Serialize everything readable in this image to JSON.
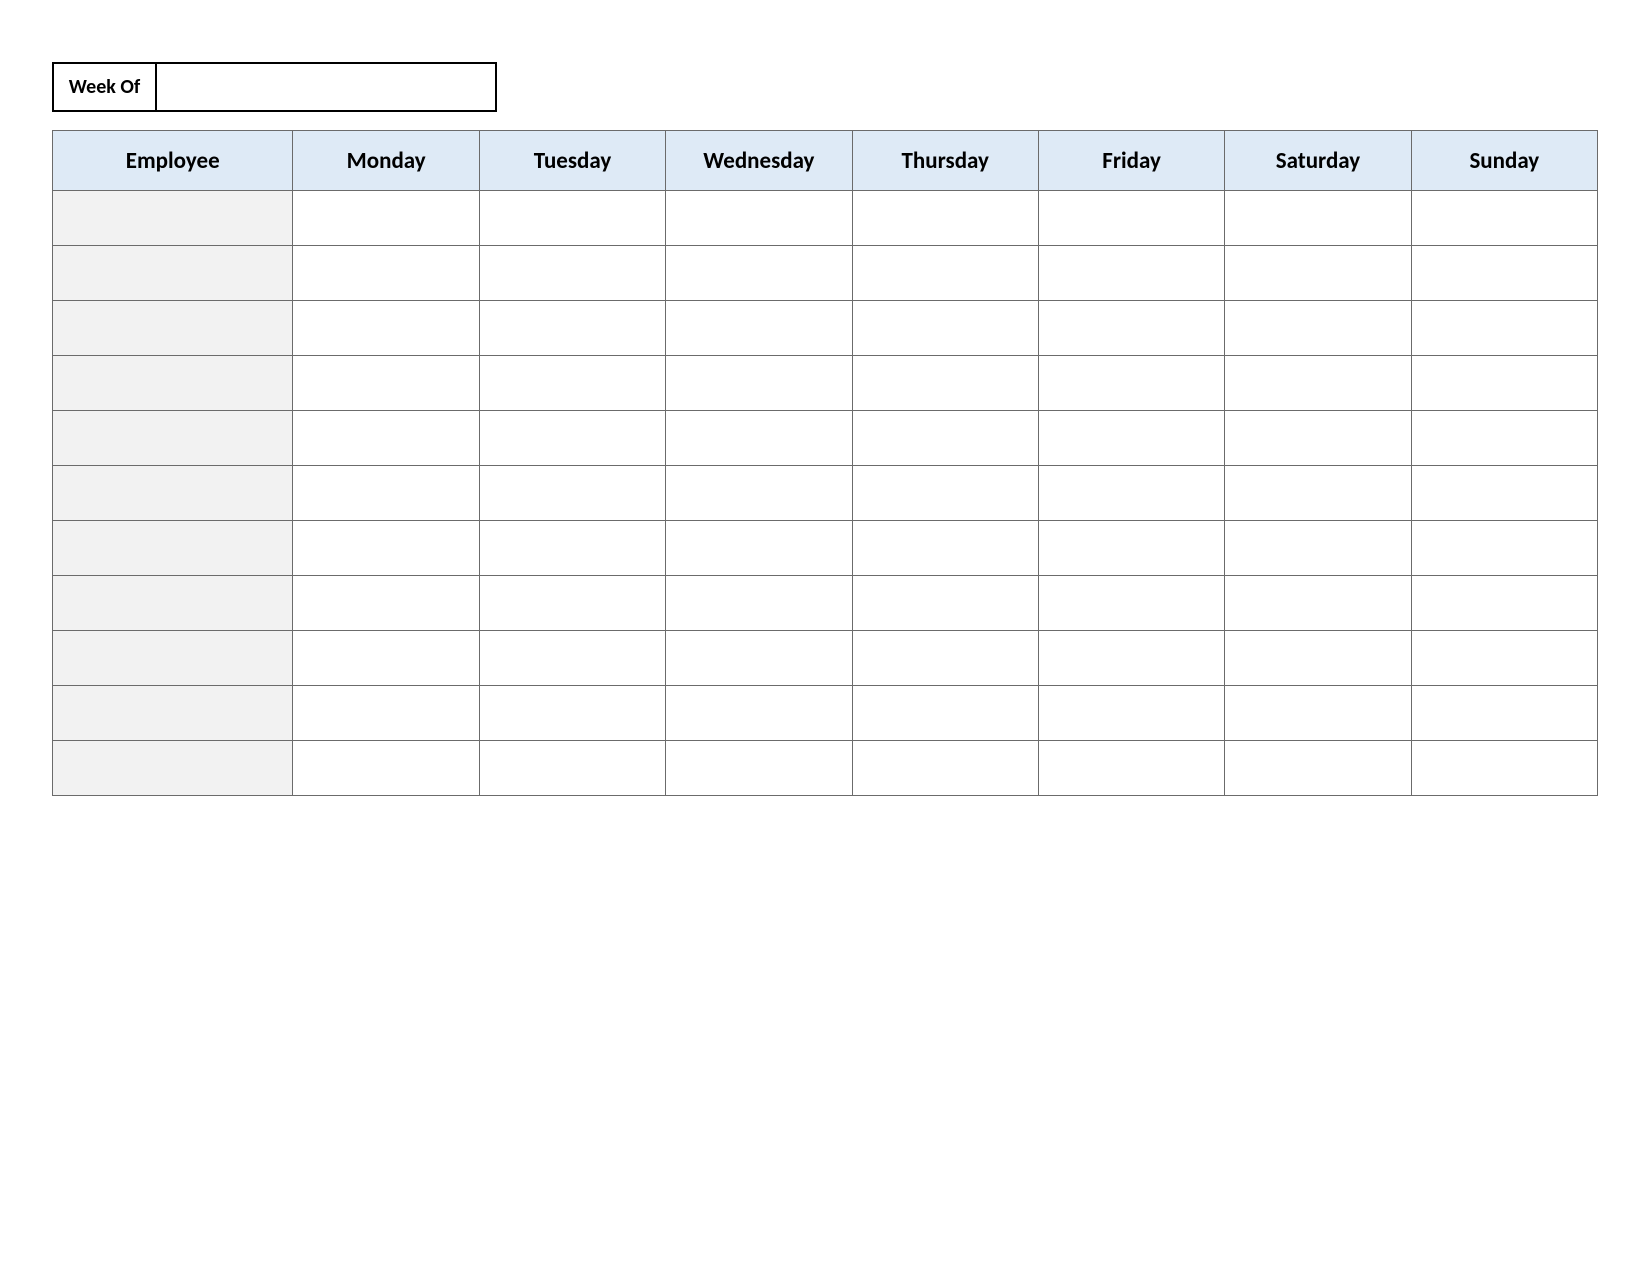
{
  "weekOf": {
    "label": "Week Of",
    "value": ""
  },
  "headers": {
    "employee": "Employee",
    "days": [
      "Monday",
      "Tuesday",
      "Wednesday",
      "Thursday",
      "Friday",
      "Saturday",
      "Sunday"
    ]
  },
  "rows": [
    {
      "employee": "",
      "cells": [
        "",
        "",
        "",
        "",
        "",
        "",
        ""
      ]
    },
    {
      "employee": "",
      "cells": [
        "",
        "",
        "",
        "",
        "",
        "",
        ""
      ]
    },
    {
      "employee": "",
      "cells": [
        "",
        "",
        "",
        "",
        "",
        "",
        ""
      ]
    },
    {
      "employee": "",
      "cells": [
        "",
        "",
        "",
        "",
        "",
        "",
        ""
      ]
    },
    {
      "employee": "",
      "cells": [
        "",
        "",
        "",
        "",
        "",
        "",
        ""
      ]
    },
    {
      "employee": "",
      "cells": [
        "",
        "",
        "",
        "",
        "",
        "",
        ""
      ]
    },
    {
      "employee": "",
      "cells": [
        "",
        "",
        "",
        "",
        "",
        "",
        ""
      ]
    },
    {
      "employee": "",
      "cells": [
        "",
        "",
        "",
        "",
        "",
        "",
        ""
      ]
    },
    {
      "employee": "",
      "cells": [
        "",
        "",
        "",
        "",
        "",
        "",
        ""
      ]
    },
    {
      "employee": "",
      "cells": [
        "",
        "",
        "",
        "",
        "",
        "",
        ""
      ]
    },
    {
      "employee": "",
      "cells": [
        "",
        "",
        "",
        "",
        "",
        "",
        ""
      ]
    }
  ],
  "colors": {
    "headerFill": "#deeaf6",
    "employeeColFill": "#f2f2f2",
    "gridBorder": "#6b6b6b",
    "boxBorder": "#000000"
  }
}
